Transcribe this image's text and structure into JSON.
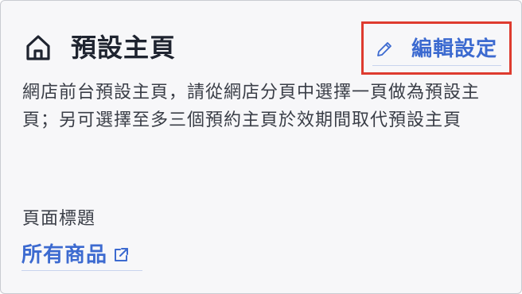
{
  "header": {
    "icon": "home-icon",
    "title": "預設主頁"
  },
  "edit_button": {
    "icon": "pencil-icon",
    "label": "編輯設定"
  },
  "description": "網店前台預設主頁，請從網店分頁中選擇一頁做為預設主頁；另可選擇至多三個預約主頁於效期間取代預設主頁",
  "field": {
    "label": "頁面標題",
    "value": "所有商品",
    "value_icon": "external-link-icon"
  },
  "colors": {
    "accent": "#3c6ad0",
    "highlight_border": "#de3b2f",
    "title": "#1f2430",
    "body_text": "#3a3e47",
    "card_bg": "#f7f7f9"
  }
}
